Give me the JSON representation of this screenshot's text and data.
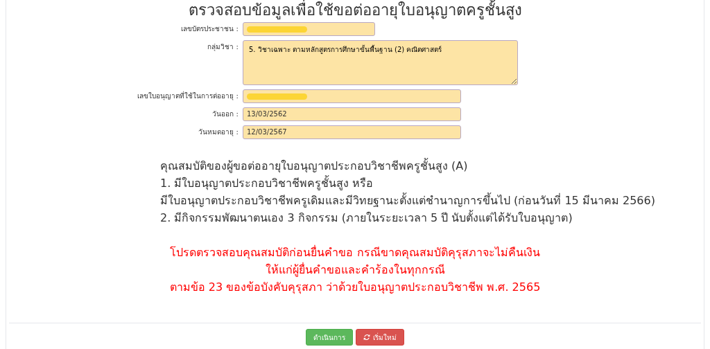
{
  "title": "ตรวจสอบข้อมูลเพื่อใช้ขอต่ออายุใบอนุญาตครูชั้นสูง",
  "fields": [
    {
      "kind": "input",
      "label": "เลขบัตรประชาชน :",
      "redacted": true
    },
    {
      "kind": "textarea",
      "label": "กลุ่มวิชา :",
      "value": "5. วิชาเฉพาะ ตามหลักสูตรการศึกษาขั้นพื้นฐาน (2) คณิตศาสตร์",
      "redacted": false
    },
    {
      "kind": "input",
      "label": "เลขใบอนุญาตที่ใช้ในการต่ออายุ :",
      "redacted": true
    },
    {
      "kind": "input",
      "label": "วันออก :",
      "value": "13/03/2562",
      "redacted": false
    },
    {
      "kind": "input",
      "label": "วันหมดอายุ :",
      "value": "12/03/2567",
      "redacted": false
    }
  ],
  "qualifications": [
    "คุณสมบัติของผู้ขอต่ออายุใบอนุญาตประกอบวิชาชีพครูชั้นสูง (A)",
    "1. มีใบอนุญาตประกอบวิชาชีพครูชั้นสูง หรือ",
    "มีใบอนุญาตประกอบวิชาชีพครูเดิมและมีวิทยฐานะตั้งแต่ชำนาญการขึ้นไป (ก่อนวันที่ 15 มีนาคม 2566)",
    "2. มีกิจกรรมพัฒนาตนเอง 3 กิจกรรม (ภายในระยะเวลา 5 ปี นับตั้งแต่ได้รับใบอนุญาต)"
  ],
  "warning": [
    "โปรดตรวจสอบคุณสมบัติก่อนยื่นคำขอ กรณีขาดคุณสมบัติคุรุสภาจะไม่คืนเงิน",
    "ให้แก่ผู้ยื่นคำขอและคำร้องในทุกกรณี",
    "ตามข้อ 23 ของข้อบังคับคุรุสภา ว่าด้วยใบอนุญาตประกอบวิชาชีพ พ.ศ. 2565"
  ],
  "buttons": [
    {
      "kind": "submit",
      "label": "ดำเนินการ"
    },
    {
      "kind": "reset",
      "label": "เริ่มใหม่"
    }
  ]
}
